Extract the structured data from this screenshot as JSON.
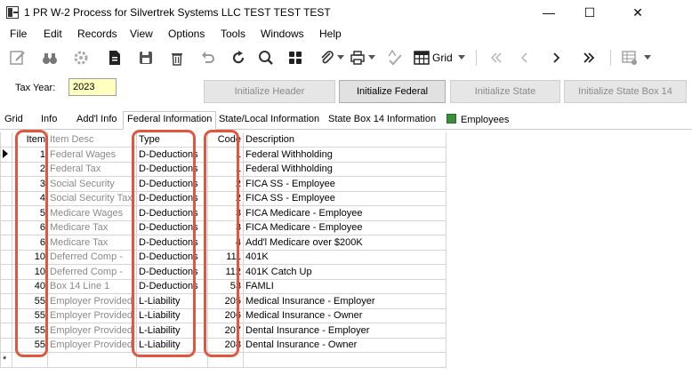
{
  "window": {
    "title": "1 PR W-2 Process for Silvertrek Systems LLC TEST TEST TEST",
    "minimize": "—",
    "maximize": "☐",
    "close": "✕"
  },
  "menu": [
    "File",
    "Edit",
    "Records",
    "View",
    "Options",
    "Tools",
    "Windows",
    "Help"
  ],
  "toolbar": {
    "grid_label": "Grid",
    "icons": [
      "edit-icon",
      "binoculars-icon",
      "settings-icon",
      "document-icon",
      "save-icon",
      "trash-icon",
      "undo-icon",
      "refresh-icon",
      "search-icon",
      "calculator-icon",
      "attach-icon",
      "print-icon",
      "spellcheck-icon",
      "grid-icon",
      "first-icon",
      "prev-icon",
      "next-icon",
      "last-icon",
      "grid-settings-icon"
    ]
  },
  "form": {
    "tax_year_label": "Tax Year:",
    "tax_year_value": "2023",
    "buttons": {
      "init_header": "Initialize Header",
      "init_federal": "Initialize Federal",
      "init_state": "Initialize State",
      "init_state_box14": "Initialize State Box 14"
    }
  },
  "tabs": [
    "Grid",
    "Info",
    "Add'l Info",
    "Federal Information",
    "State/Local Information",
    "State Box 14 Information",
    "Employees"
  ],
  "active_tab": "Federal Information",
  "grid": {
    "columns": [
      "Item",
      "Item Desc",
      "Type",
      "Code",
      "Description"
    ],
    "rows": [
      {
        "item": "1",
        "desc": "Federal Wages",
        "type": "D-Deductions",
        "code": "1",
        "description": "Federal Withholding"
      },
      {
        "item": "2",
        "desc": "Federal Tax",
        "type": "D-Deductions",
        "code": "1",
        "description": "Federal Withholding"
      },
      {
        "item": "3",
        "desc": "Social Security",
        "type": "D-Deductions",
        "code": "2",
        "description": "FICA SS - Employee"
      },
      {
        "item": "4",
        "desc": "Social Security Tax",
        "type": "D-Deductions",
        "code": "2",
        "description": "FICA SS - Employee"
      },
      {
        "item": "5",
        "desc": "Medicare Wages",
        "type": "D-Deductions",
        "code": "3",
        "description": "FICA Medicare - Employee"
      },
      {
        "item": "6",
        "desc": "Medicare Tax",
        "type": "D-Deductions",
        "code": "3",
        "description": "FICA Medicare - Employee"
      },
      {
        "item": "6",
        "desc": "Medicare Tax",
        "type": "D-Deductions",
        "code": "4",
        "description": "Add'l Medicare over $200K"
      },
      {
        "item": "10",
        "desc": "Deferred Comp -",
        "type": "D-Deductions",
        "code": "111",
        "description": "401K"
      },
      {
        "item": "10",
        "desc": "Deferred Comp -",
        "type": "D-Deductions",
        "code": "112",
        "description": "401K Catch Up"
      },
      {
        "item": "40",
        "desc": "Box 14 Line 1",
        "type": "D-Deductions",
        "code": "53",
        "description": "FAMLI"
      },
      {
        "item": "55",
        "desc": "Employer Provided",
        "type": "L-Liability",
        "code": "205",
        "description": "Medical Insurance - Employer"
      },
      {
        "item": "55",
        "desc": "Employer Provided",
        "type": "L-Liability",
        "code": "206",
        "description": "Medical Insurance - Owner"
      },
      {
        "item": "55",
        "desc": "Employer Provided",
        "type": "L-Liability",
        "code": "207",
        "description": "Dental Insurance - Employer"
      },
      {
        "item": "55",
        "desc": "Employer Provided",
        "type": "L-Liability",
        "code": "208",
        "description": "Dental Insurance - Owner"
      }
    ],
    "new_row_marker": "*",
    "highlight_color": "#e2563f"
  }
}
